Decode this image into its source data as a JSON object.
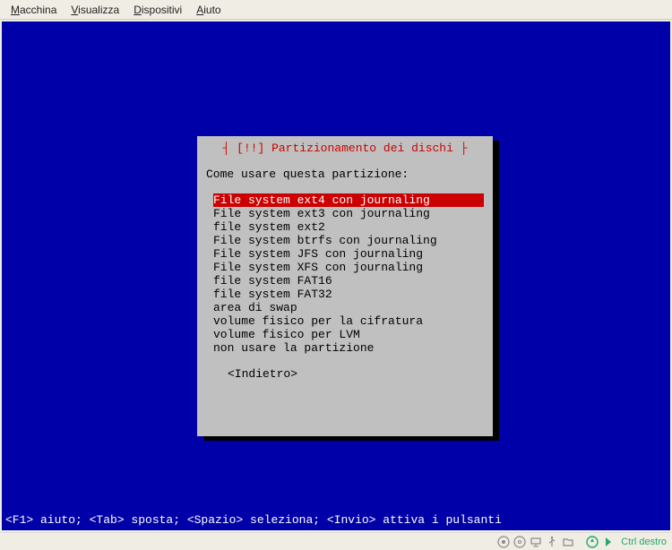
{
  "menubar": {
    "items": [
      {
        "label": "Macchina",
        "underline": "M"
      },
      {
        "label": "Visualizza",
        "underline": "V"
      },
      {
        "label": "Dispositivi",
        "underline": "D"
      },
      {
        "label": "Aiuto",
        "underline": "A"
      }
    ]
  },
  "dialog": {
    "title_line": "┤ [!!] Partizionamento dei dischi ├",
    "prompt": "Come usare questa partizione:",
    "options": [
      "File system ext4 con journaling",
      "File system ext3 con journaling",
      "file system ext2",
      "File system btrfs con journaling",
      "File system JFS con journaling",
      "File system XFS con journaling",
      "file system FAT16",
      "file system FAT32",
      "area di swap",
      "volume fisico per la cifratura",
      "volume fisico per LVM",
      "non usare la partizione"
    ],
    "selected_index": 0,
    "back_label": "<Indietro>"
  },
  "statusline": "<F1> aiuto; <Tab> sposta; <Spazio> seleziona; <Invio> attiva i pulsanti",
  "host_statusbar": {
    "host_key": "Ctrl destro"
  }
}
